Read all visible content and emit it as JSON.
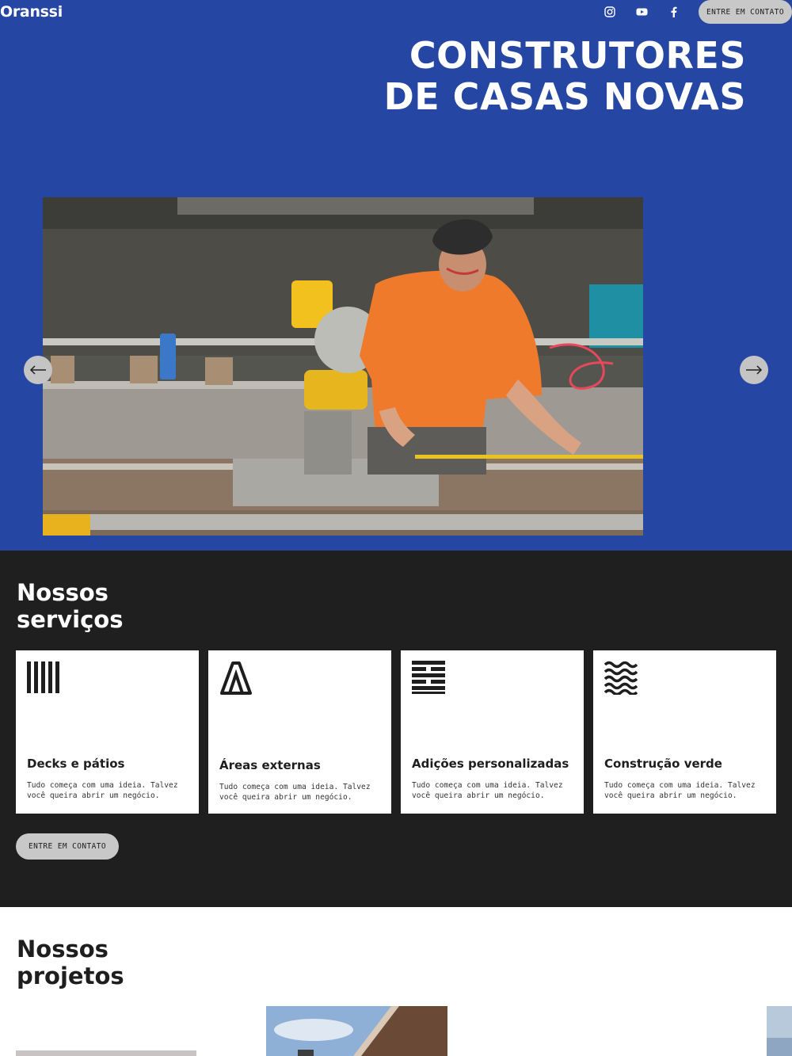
{
  "header": {
    "logo": "Oranssi",
    "social": [
      "instagram-icon",
      "youtube-icon",
      "facebook-icon"
    ],
    "cta_label": "ENTRE EM CONTATO"
  },
  "hero": {
    "title_line1": "CONSTRUTORES",
    "title_line2": "DE CASAS NOVAS",
    "background": "#2546a3",
    "carousel": {
      "prev": "arrow-left-icon",
      "next": "arrow-right-icon"
    }
  },
  "services": {
    "title_line1": "Nossos",
    "title_line2": "serviços",
    "background": "#1f1f1f",
    "items": [
      {
        "icon": "vertical-bars-icon",
        "title": "Decks e pátios",
        "description": "Tudo começa com uma ideia. Talvez você queira abrir um negócio."
      },
      {
        "icon": "abstract-a-icon",
        "title": "Áreas externas",
        "description": "Tudo começa com uma ideia. Talvez você queira abrir um negócio."
      },
      {
        "icon": "hexagram-lines-icon",
        "title": "Adições personalizadas",
        "description": "Tudo começa com uma ideia. Talvez você queira abrir um negócio."
      },
      {
        "icon": "waves-icon",
        "title": "Construção verde",
        "description": "Tudo começa com uma ideia. Talvez você queira abrir um negócio."
      }
    ],
    "cta_label": "ENTRE EM CONTATO"
  },
  "projects": {
    "title_line1": "Nossos",
    "title_line2": "projetos"
  }
}
